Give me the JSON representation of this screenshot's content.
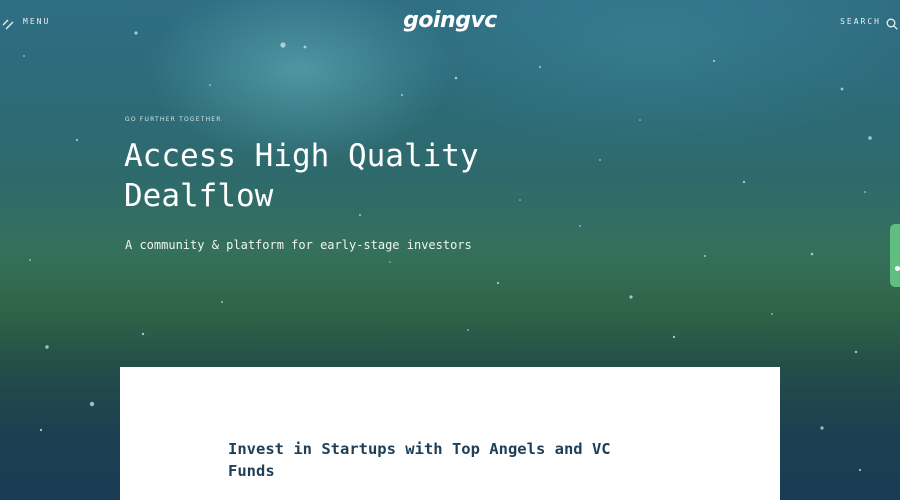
{
  "header": {
    "menu_label": "MENU",
    "menu_icon": "double-slash-menu-icon",
    "logo_text": "goingvc",
    "search_label": "SEARCH",
    "search_icon": "magnifier-icon"
  },
  "hero": {
    "eyebrow": "GO FURTHER TOGETHER",
    "headline": "Access High Quality Dealflow",
    "tagline": "A community & platform for early-stage investors"
  },
  "card": {
    "title": "Invest in Startups with Top Angels and VC Funds"
  },
  "colors": {
    "card_title": "#1e3f57",
    "side_tab": "#5fbf7e",
    "hero_text": "#ffffff"
  }
}
